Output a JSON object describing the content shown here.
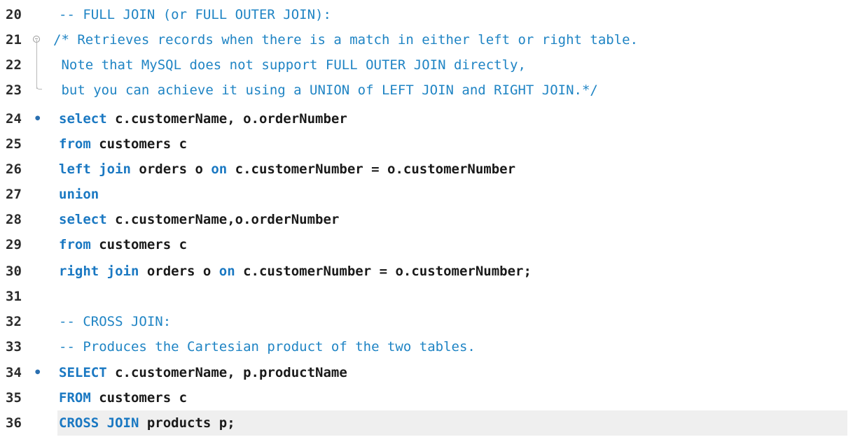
{
  "editor": {
    "lines": [
      {
        "num": "20",
        "code": "-- FULL JOIN (or FULL OUTER JOIN):"
      },
      {
        "num": "21",
        "code": "/* Retrieves records when there is a match in either left or right table."
      },
      {
        "num": "22",
        "code": " Note that MySQL does not support FULL OUTER JOIN directly,"
      },
      {
        "num": "23",
        "code": " but you can achieve it using a UNION of LEFT JOIN and RIGHT JOIN.*/"
      },
      {
        "num": "24",
        "kw1": "select",
        "rest1": " c.customerName, o.orderNumber"
      },
      {
        "num": "25",
        "kw1": "from",
        "rest1": " customers c"
      },
      {
        "num": "26",
        "kw1": "left join",
        "rest1": " orders o ",
        "kw2": "on",
        "rest2": " c.customerNumber = o.customerNumber"
      },
      {
        "num": "27",
        "kw1": "union"
      },
      {
        "num": "28",
        "kw1": "select",
        "rest1": " c.customerName,o.orderNumber"
      },
      {
        "num": "29",
        "kw1": "from",
        "rest1": " customers c"
      },
      {
        "num": "30",
        "kw1": "right join",
        "rest1": " orders o ",
        "kw2": "on",
        "rest2": " c.customerNumber = o.customerNumber;"
      },
      {
        "num": "31"
      },
      {
        "num": "32",
        "code": "-- CROSS JOIN:"
      },
      {
        "num": "33",
        "code": "-- Produces the Cartesian product of the two tables."
      },
      {
        "num": "34",
        "kw1": "SELECT",
        "rest1": " c.customerName, p.productName"
      },
      {
        "num": "35",
        "kw1": "FROM",
        "rest1": " customers c"
      },
      {
        "num": "36",
        "kw1": "CROSS JOIN",
        "rest1": " products p;"
      }
    ],
    "statement_marker": "•",
    "colors": {
      "keyword": "#1a78c2",
      "comment": "#1f84c4",
      "current_line_bg": "#efefef"
    }
  }
}
